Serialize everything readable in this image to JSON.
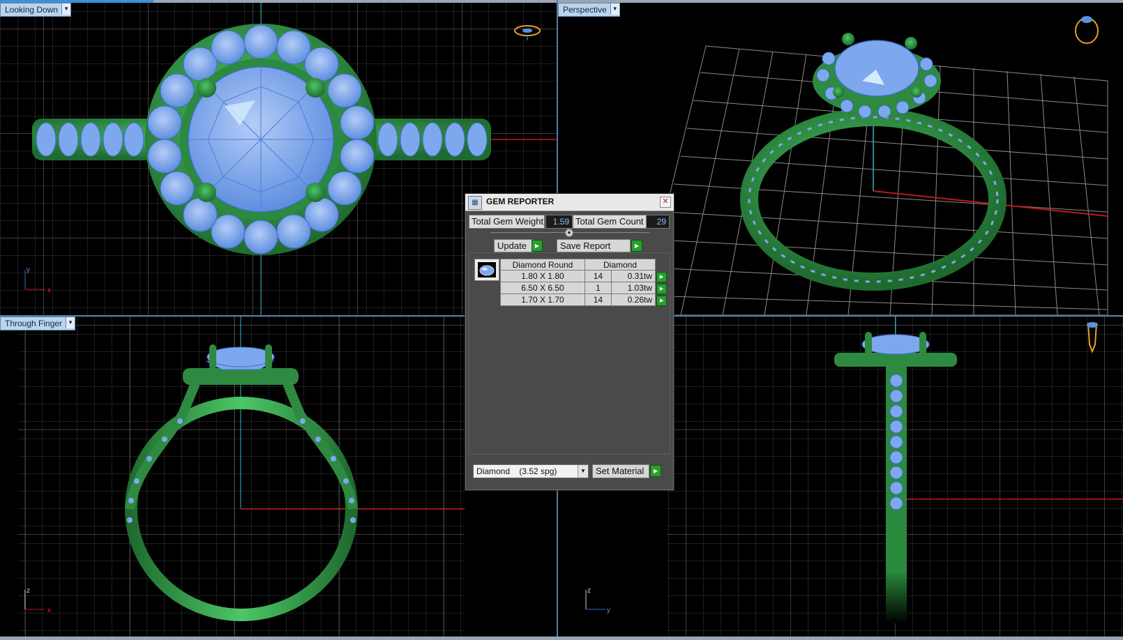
{
  "viewports": {
    "top_left": {
      "label": "Looking Down",
      "axes": [
        "y",
        "x"
      ]
    },
    "top_right": {
      "label": "Perspective"
    },
    "bottom_left": {
      "label": "Through Finger",
      "axes": [
        "z",
        "x"
      ]
    },
    "bottom_right": {
      "axes": [
        "z",
        "y"
      ]
    }
  },
  "dialog": {
    "title": "GEM REPORTER",
    "total_weight_label": "Total Gem Weight",
    "total_weight_value": "1.59",
    "total_count_label": "Total Gem Count",
    "total_count_value": "29",
    "update_label": "Update",
    "save_report_label": "Save Report",
    "table": {
      "headers": [
        "Diamond Round",
        "Diamond"
      ],
      "rows": [
        {
          "size": "1.80 X 1.80",
          "count": "14",
          "weight": "0.31tw"
        },
        {
          "size": "6.50 X 6.50",
          "count": "1",
          "weight": "1.03tw"
        },
        {
          "size": "1.70 X 1.70",
          "count": "14",
          "weight": "0.26tw"
        }
      ]
    },
    "material_select": "Diamond    (3.52 spg)",
    "set_material_label": "Set Material"
  },
  "colors": {
    "metal": "#2f9a45",
    "gem": "#7ea8ee",
    "grid": "#8f8f8f",
    "axis_red": "#c0181a",
    "axis_cyan": "#2fb5c5"
  },
  "icons": {
    "play": "green-play-icon",
    "close": "close-icon",
    "dropdown": "chevron-down-icon",
    "view_cube_top": "ring-orientation-icon",
    "view_cube_persp": "ring-orientation-icon",
    "view_cube_side": "ring-orientation-icon"
  }
}
